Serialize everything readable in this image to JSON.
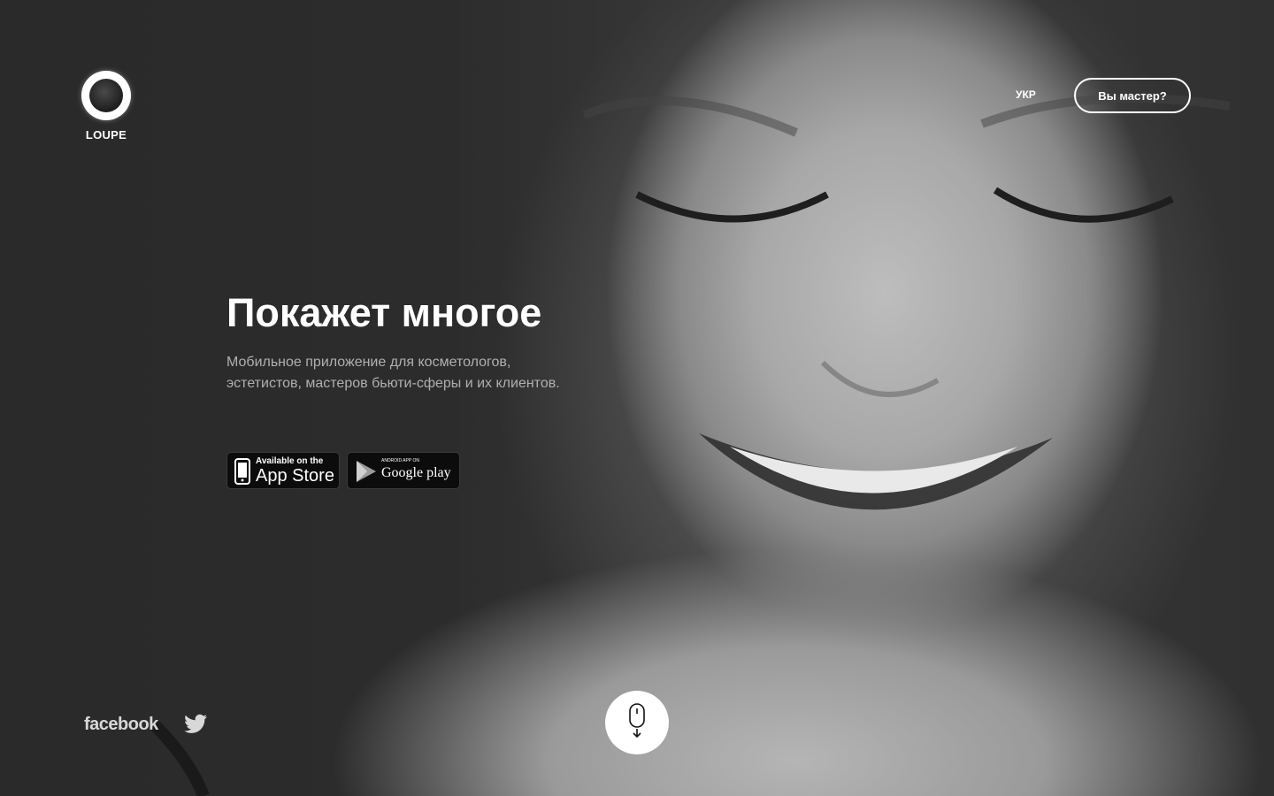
{
  "brand": {
    "name": "LOUPE"
  },
  "nav": {
    "lang": "УКР",
    "master_button": "Вы мастер?"
  },
  "hero": {
    "title": "Покажет многое",
    "description": "Мобильное приложение для косметологов, эстетистов, мастеров бьюти-сферы и их клиентов."
  },
  "stores": {
    "appstore": {
      "small": "Available on the",
      "big": "App Store"
    },
    "google": {
      "small": "ANDROID APP ON",
      "big": "Google play"
    }
  },
  "social": {
    "facebook": "facebook",
    "twitter_icon": "twitter-bird-icon"
  },
  "scroll": {
    "icon": "mouse-scroll-down-icon"
  },
  "colors": {
    "background": "#2a2a2a",
    "text": "#ffffff",
    "muted": "#b0b0b0",
    "badge": "#0c0c0c"
  }
}
